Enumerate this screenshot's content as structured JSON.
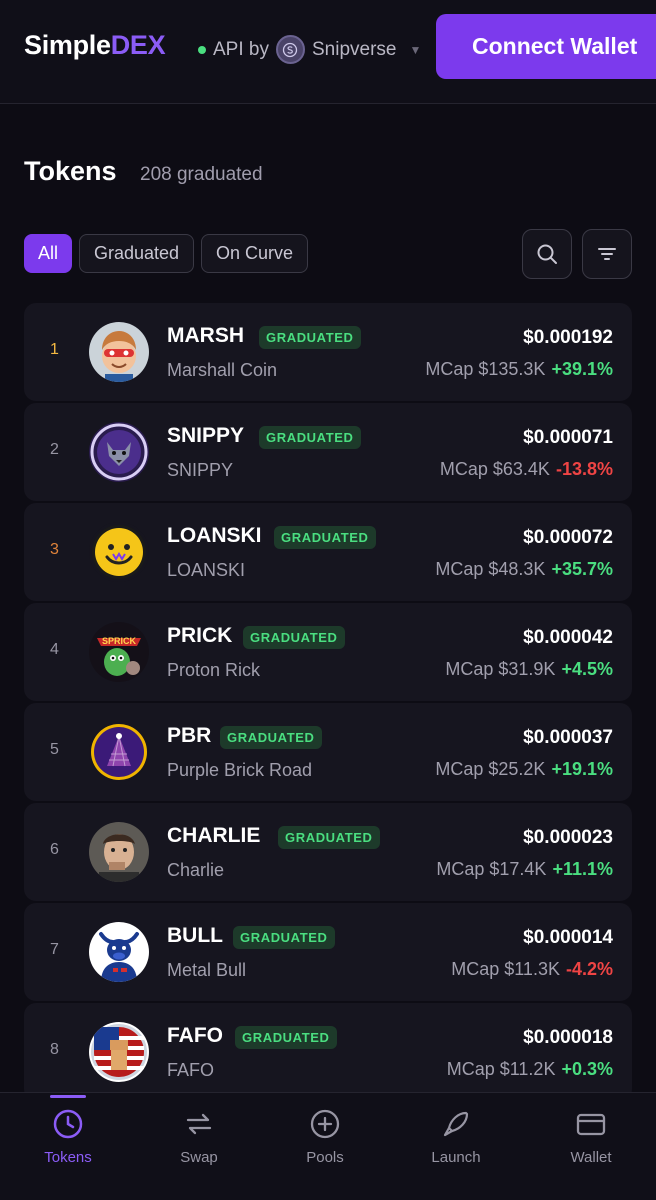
{
  "header": {
    "logo_main": "Simple",
    "logo_accent": "DEX",
    "api_label": "API by",
    "api_provider": "Snipverse",
    "connect_label": "Connect Wallet"
  },
  "tokens": {
    "title": "Tokens",
    "count": "208 graduated"
  },
  "filters": {
    "all": "All",
    "graduated": "Graduated",
    "on_curve": "On Curve"
  },
  "badge_label": "GRADUATED",
  "rows": [
    {
      "rank": "1",
      "symbol": "MARSH",
      "name": "Marshall Coin",
      "price": "$0.000192",
      "mcap": "MCap $135.3K",
      "change": "+39.1%"
    },
    {
      "rank": "2",
      "symbol": "SNIPPY",
      "name": "SNIPPY",
      "price": "$0.000071",
      "mcap": "MCap $63.4K",
      "change": "-13.8%"
    },
    {
      "rank": "3",
      "symbol": "LOANSKI",
      "name": "LOANSKI",
      "price": "$0.000072",
      "mcap": "MCap $48.3K",
      "change": "+35.7%"
    },
    {
      "rank": "4",
      "symbol": "PRICK",
      "name": "Proton Rick",
      "price": "$0.000042",
      "mcap": "MCap $31.9K",
      "change": "+4.5%"
    },
    {
      "rank": "5",
      "symbol": "PBR",
      "name": "Purple Brick Road",
      "price": "$0.000037",
      "mcap": "MCap $25.2K",
      "change": "+19.1%"
    },
    {
      "rank": "6",
      "symbol": "CHARLIE",
      "name": "Charlie",
      "price": "$0.000023",
      "mcap": "MCap $17.4K",
      "change": "+11.1%"
    },
    {
      "rank": "7",
      "symbol": "BULL",
      "name": "Metal Bull",
      "price": "$0.000014",
      "mcap": "MCap $11.3K",
      "change": "-4.2%"
    },
    {
      "rank": "8",
      "symbol": "FAFO",
      "name": "FAFO",
      "price": "$0.000018",
      "mcap": "MCap $11.2K",
      "change": "+0.3%"
    }
  ],
  "nav": {
    "tokens": "Tokens",
    "swap": "Swap",
    "pools": "Pools",
    "launch": "Launch",
    "wallet": "Wallet"
  },
  "colors": {
    "accent": "#7c3aed",
    "up": "#4ade80",
    "down": "#ef4444"
  }
}
